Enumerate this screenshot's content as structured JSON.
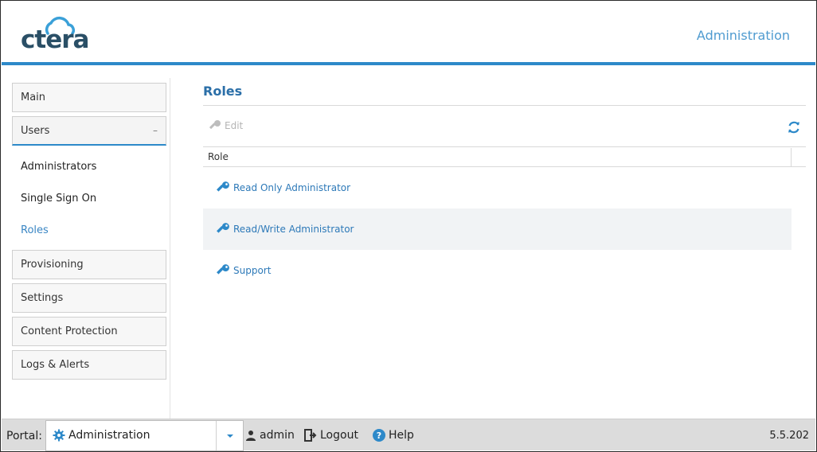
{
  "header": {
    "logo_text": "ctera",
    "title": "Administration"
  },
  "sidebar": {
    "items": [
      {
        "label": "Main"
      },
      {
        "label": "Users",
        "toggle": "–"
      },
      {
        "label": "Provisioning"
      },
      {
        "label": "Settings"
      },
      {
        "label": "Content Protection"
      },
      {
        "label": "Logs & Alerts"
      }
    ],
    "users_sub": [
      {
        "label": "Administrators"
      },
      {
        "label": "Single Sign On"
      },
      {
        "label": "Roles",
        "active": true
      }
    ]
  },
  "main": {
    "title": "Roles",
    "toolbar": {
      "edit_label": "Edit",
      "refresh_icon": "refresh-icon"
    },
    "grid": {
      "column": "Role",
      "rows": [
        {
          "label": "Read Only Administrator",
          "icon": "key-icon"
        },
        {
          "label": "Read/Write Administrator",
          "icon": "key-icon"
        },
        {
          "label": "Support",
          "icon": "key-icon"
        }
      ]
    }
  },
  "footer": {
    "portal_label": "Portal:",
    "portal_value": "Administration",
    "user": "admin",
    "logout": "Logout",
    "help": "Help",
    "version": "5.5.202"
  },
  "colors": {
    "accent": "#2d89c9",
    "link": "#2d79b8",
    "logo": "#2a4f66"
  }
}
